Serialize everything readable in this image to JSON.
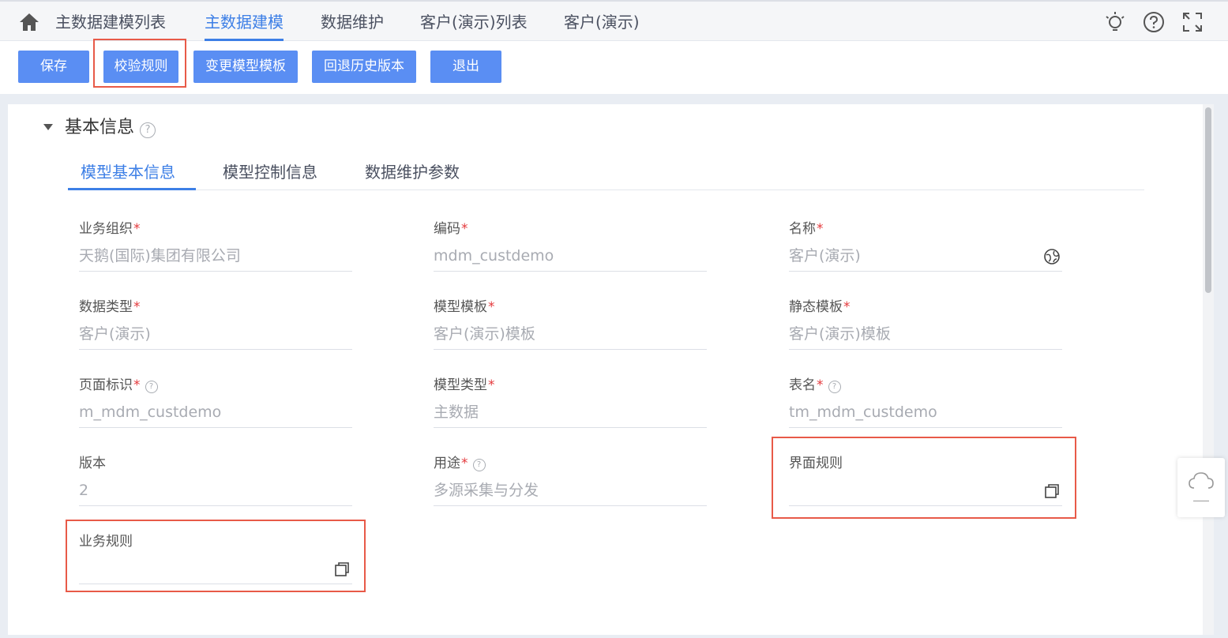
{
  "nav": {
    "tabs": [
      {
        "label": "主数据建模列表"
      },
      {
        "label": "主数据建模"
      },
      {
        "label": "数据维护"
      },
      {
        "label": "客户(演示)列表"
      },
      {
        "label": "客户(演示)"
      }
    ],
    "active_tab": 1,
    "icons": [
      "home-icon",
      "lightbulb-icon",
      "help-icon",
      "fullscreen-icon"
    ]
  },
  "toolbar": {
    "save": "保存",
    "validate_rules": "校验规则",
    "change_template": "变更模型模板",
    "rollback_version": "回退历史版本",
    "exit": "退出"
  },
  "section": {
    "title": "基本信息",
    "tabs": [
      {
        "label": "模型基本信息"
      },
      {
        "label": "模型控制信息"
      },
      {
        "label": "数据维护参数"
      }
    ],
    "active_tab": 0
  },
  "fields": {
    "org": {
      "label": "业务组织",
      "value": "天鹅(国际)集团有限公司"
    },
    "code": {
      "label": "编码",
      "value": "mdm_custdemo"
    },
    "name": {
      "label": "名称",
      "value": "客户(演示)"
    },
    "data_type": {
      "label": "数据类型",
      "value": "客户(演示)"
    },
    "model_template": {
      "label": "模型模板",
      "value": "客户(演示)模板"
    },
    "static_template": {
      "label": "静态模板",
      "value": "客户(演示)模板"
    },
    "page_id": {
      "label": "页面标识",
      "value": "m_mdm_custdemo"
    },
    "model_type": {
      "label": "模型类型",
      "value": "主数据"
    },
    "table_name": {
      "label": "表名",
      "value": "tm_mdm_custdemo"
    },
    "version": {
      "label": "版本",
      "value": "2"
    },
    "purpose": {
      "label": "用途",
      "value": "多源采集与分发"
    },
    "ui_rules": {
      "label": "界面规则",
      "value": ""
    },
    "biz_rules": {
      "label": "业务规则",
      "value": ""
    }
  },
  "required_mark": "*",
  "help_glyph": "?",
  "colors": {
    "accent": "#3d7fe6",
    "button": "#5a8ef3",
    "required": "#e4393c",
    "highlight": "#e85a48"
  }
}
